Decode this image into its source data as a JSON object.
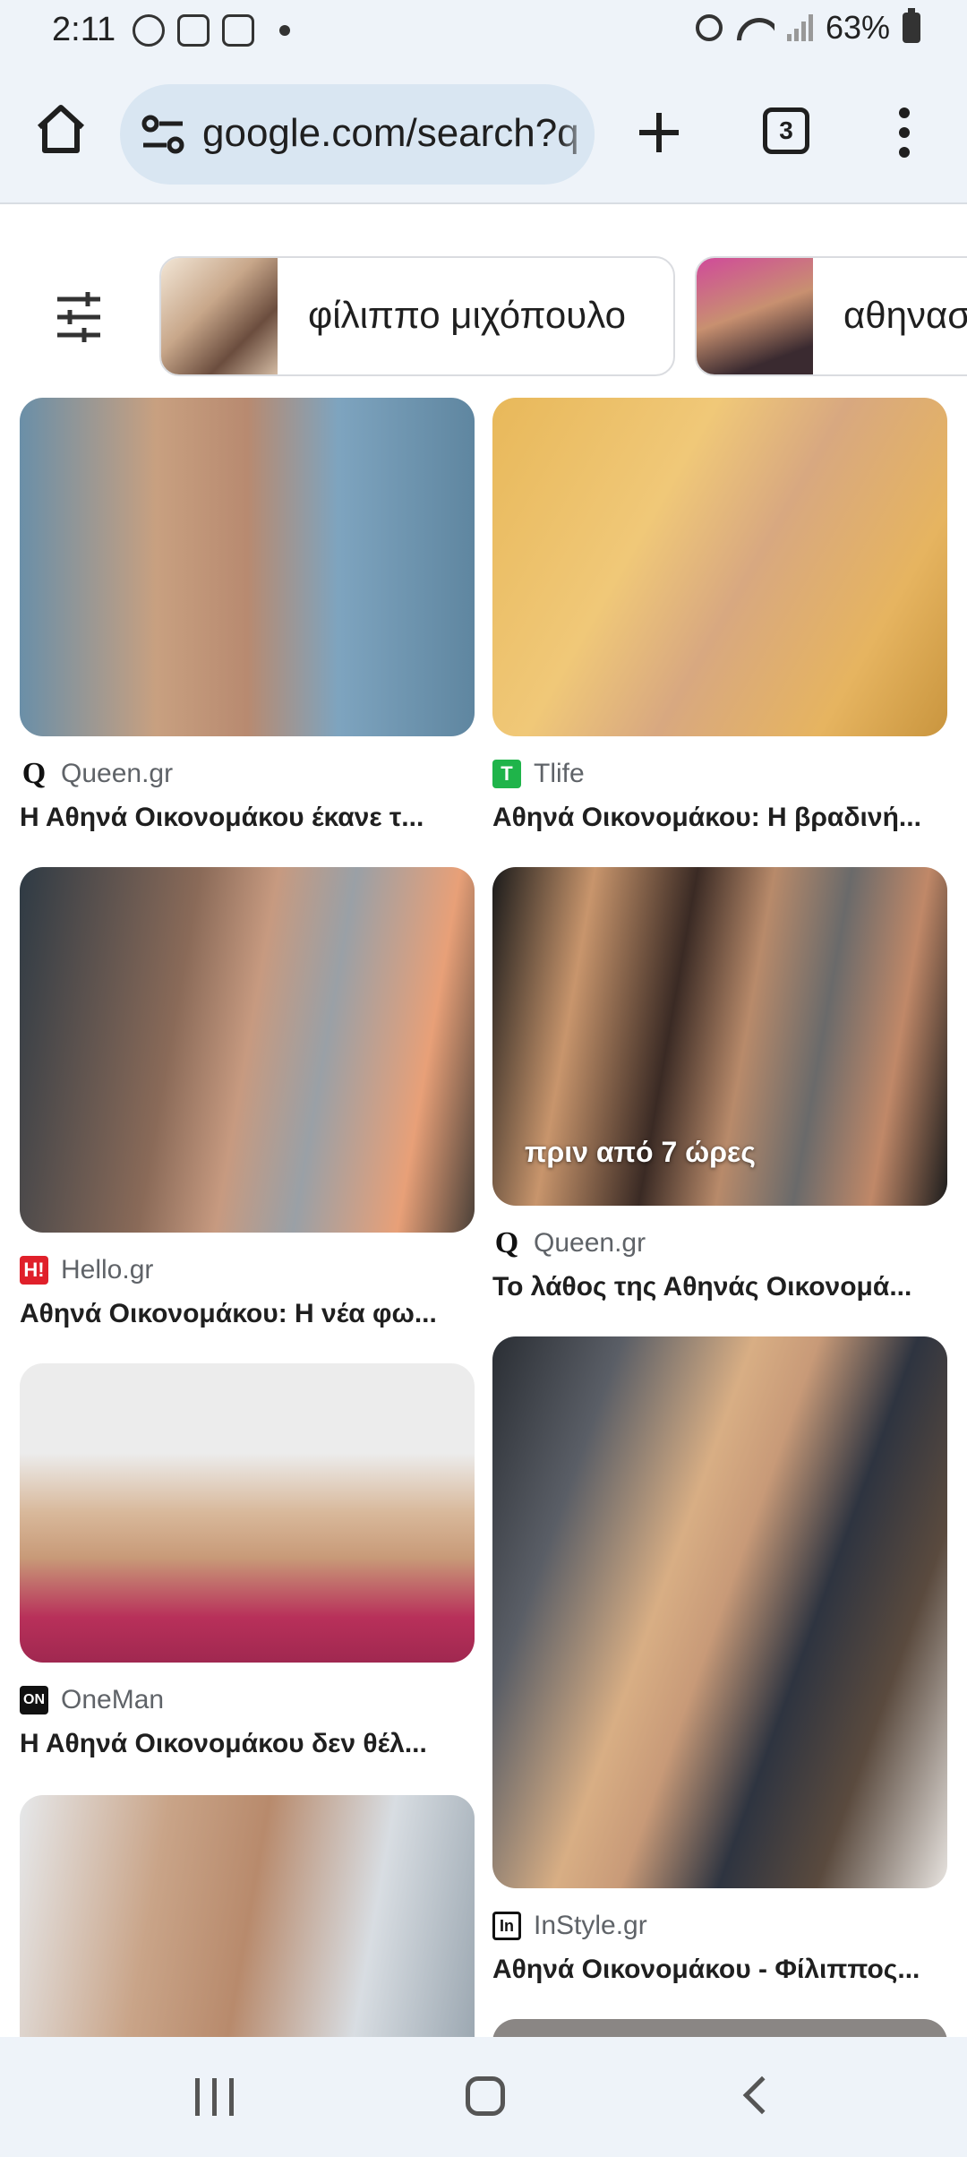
{
  "status_bar": {
    "time": "2:11",
    "battery": "63%"
  },
  "browser": {
    "url": "google.com/search?q",
    "tab_count": "3"
  },
  "chips": [
    {
      "label": "φίλιππο μιχόπουλο"
    },
    {
      "label": "αθηνασ"
    }
  ],
  "results": [
    {
      "source": "Queen.gr",
      "source_icon": "Q",
      "title": "Η Αθηνά Οικονομάκου έκανε τ..."
    },
    {
      "source": "Tlife",
      "source_icon": "T",
      "title": "Αθηνά Οικονομάκου: Η βραδινή..."
    },
    {
      "source": "Hello.gr",
      "source_icon": "H!",
      "title": "Αθηνά Οικονομάκου: Η νέα φω..."
    },
    {
      "source": "Queen.gr",
      "source_icon": "Q",
      "title": "Το λάθος της Αθηνάς Οικονομά...",
      "badge": "πριν από 7 ώρες"
    },
    {
      "source": "OneMan",
      "source_icon": "ON",
      "title": "Η Αθηνά Οικονομάκου δεν θέλ..."
    },
    {
      "source": "InStyle.gr",
      "source_icon": "In",
      "title": "Αθηνά Οικονομάκου - Φίλιππος..."
    }
  ],
  "colors": {
    "chrome_bg": "#eef3f9",
    "url_pill": "#d9e6f2",
    "tlife_green": "#1fb44a",
    "hello_red": "#e0202a"
  }
}
